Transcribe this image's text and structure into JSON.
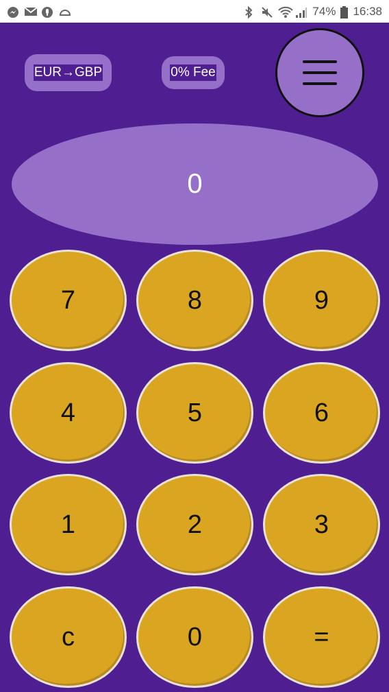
{
  "status_bar": {
    "battery": "74%",
    "time": "16:38",
    "icons": [
      "messenger-icon",
      "mail-icon",
      "voicemail-icon",
      "cloud-icon",
      "bluetooth-icon",
      "mute-icon",
      "wifi-icon",
      "signal-icon",
      "battery-icon"
    ]
  },
  "toolbar": {
    "conversion_label": "EUR→GBP",
    "fee_label": "0% Fee",
    "menu_icon": "hamburger-menu-icon"
  },
  "display": {
    "value": "0"
  },
  "keypad": {
    "k7": "7",
    "k8": "8",
    "k9": "9",
    "k4": "4",
    "k5": "5",
    "k6": "6",
    "k1": "1",
    "k2": "2",
    "k3": "3",
    "kc": "c",
    "k0": "0",
    "keq": "="
  },
  "colors": {
    "background": "#4f1f91",
    "accent": "#9670c8",
    "key": "#daa520"
  }
}
